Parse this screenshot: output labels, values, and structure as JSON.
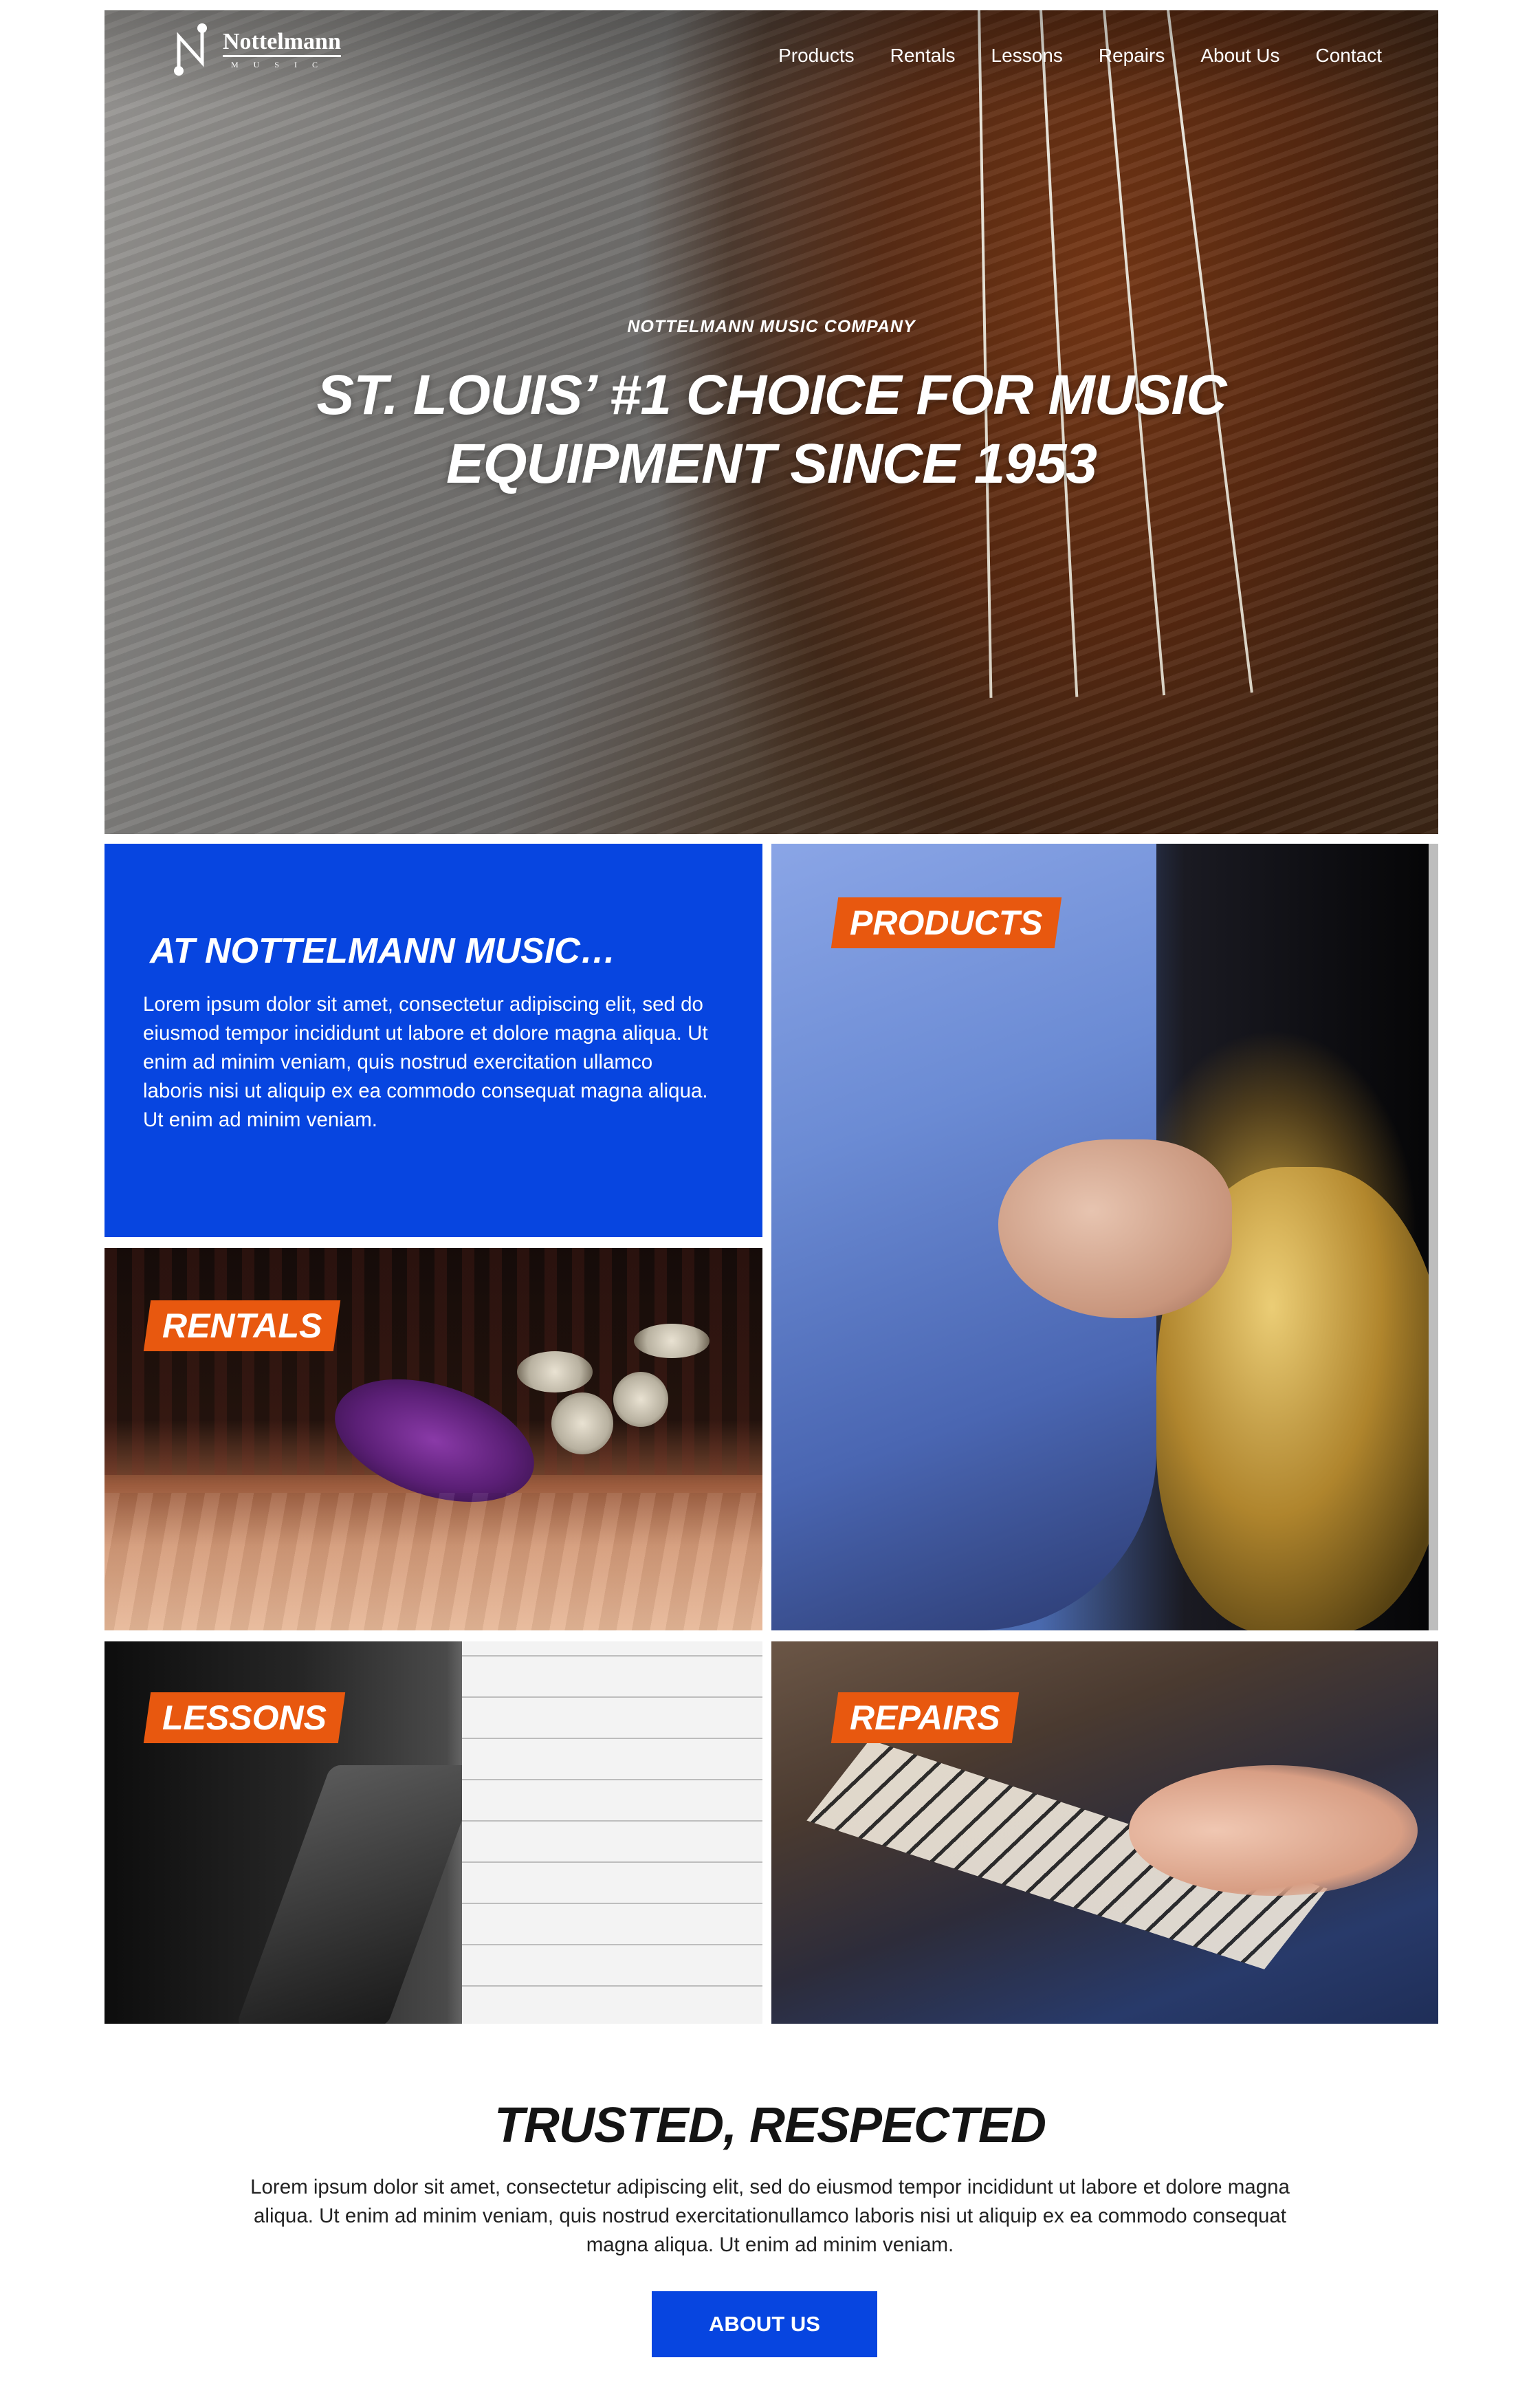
{
  "brand": {
    "name": "Nottelmann",
    "sub": "MUSIC"
  },
  "nav": [
    {
      "label": "Products"
    },
    {
      "label": "Rentals"
    },
    {
      "label": "Lessons"
    },
    {
      "label": "Repairs"
    },
    {
      "label": "About Us"
    },
    {
      "label": "Contact"
    }
  ],
  "hero": {
    "eyebrow": "NOTTELMANN MUSIC COMPANY",
    "title": "ST. LOUIS’ #1 CHOICE FOR MUSIC EQUIPMENT SINCE 1953"
  },
  "intro": {
    "title": "AT NOTTELMANN MUSIC…",
    "body": "Lorem ipsum dolor sit amet, consectetur adipiscing elit, sed do eiusmod tempor incididunt ut labore et dolore magna aliqua. Ut enim ad minim veniam, quis nostrud exercitation ullamco laboris nisi ut aliquip ex ea commodo consequat magna aliqua. Ut enim ad minim veniam."
  },
  "tiles": {
    "products": "PRODUCTS",
    "rentals": "RENTALS",
    "lessons": "LESSONS",
    "repairs": "REPAIRS"
  },
  "trusted": {
    "title": "TRUSTED, RESPECTED",
    "body": "Lorem ipsum dolor sit amet, consectetur adipiscing elit, sed do eiusmod tempor incididunt ut labore et dolore magna aliqua. Ut enim ad minim veniam, quis nostrud exercitationullamco laboris nisi ut aliquip ex ea commodo consequat magna aliqua. Ut enim ad minim veniam.",
    "button": "ABOUT US"
  },
  "colors": {
    "brand_blue": "#0745e0",
    "badge_orange": "#e8580f"
  }
}
